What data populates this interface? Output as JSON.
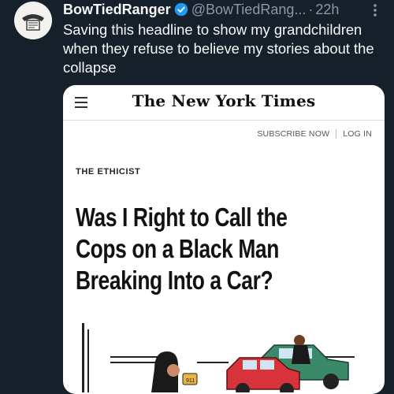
{
  "tweet": {
    "display_name": "BowTiedRanger",
    "handle": "@BowTiedRang...",
    "separator": "·",
    "time": "22h",
    "text": "Saving this headline to show my grandchildren when they refuse to believe my stories about the collapse"
  },
  "media": {
    "masthead": "The New York Times",
    "subscribe_label": "SUBSCRIBE NOW",
    "login_label": "LOG IN",
    "section": "THE ETHICIST",
    "headline": "Was I Right to Call the Cops on a Black Man Breaking Into a Car?",
    "illustration_phone_text": "911"
  },
  "icons": {
    "verified": "verified-badge-icon",
    "more": "more-options-icon",
    "menu": "hamburger-menu-icon"
  },
  "colors": {
    "background": "#15202b",
    "verified": "#1d9bf0",
    "muted": "#8b98a5"
  }
}
